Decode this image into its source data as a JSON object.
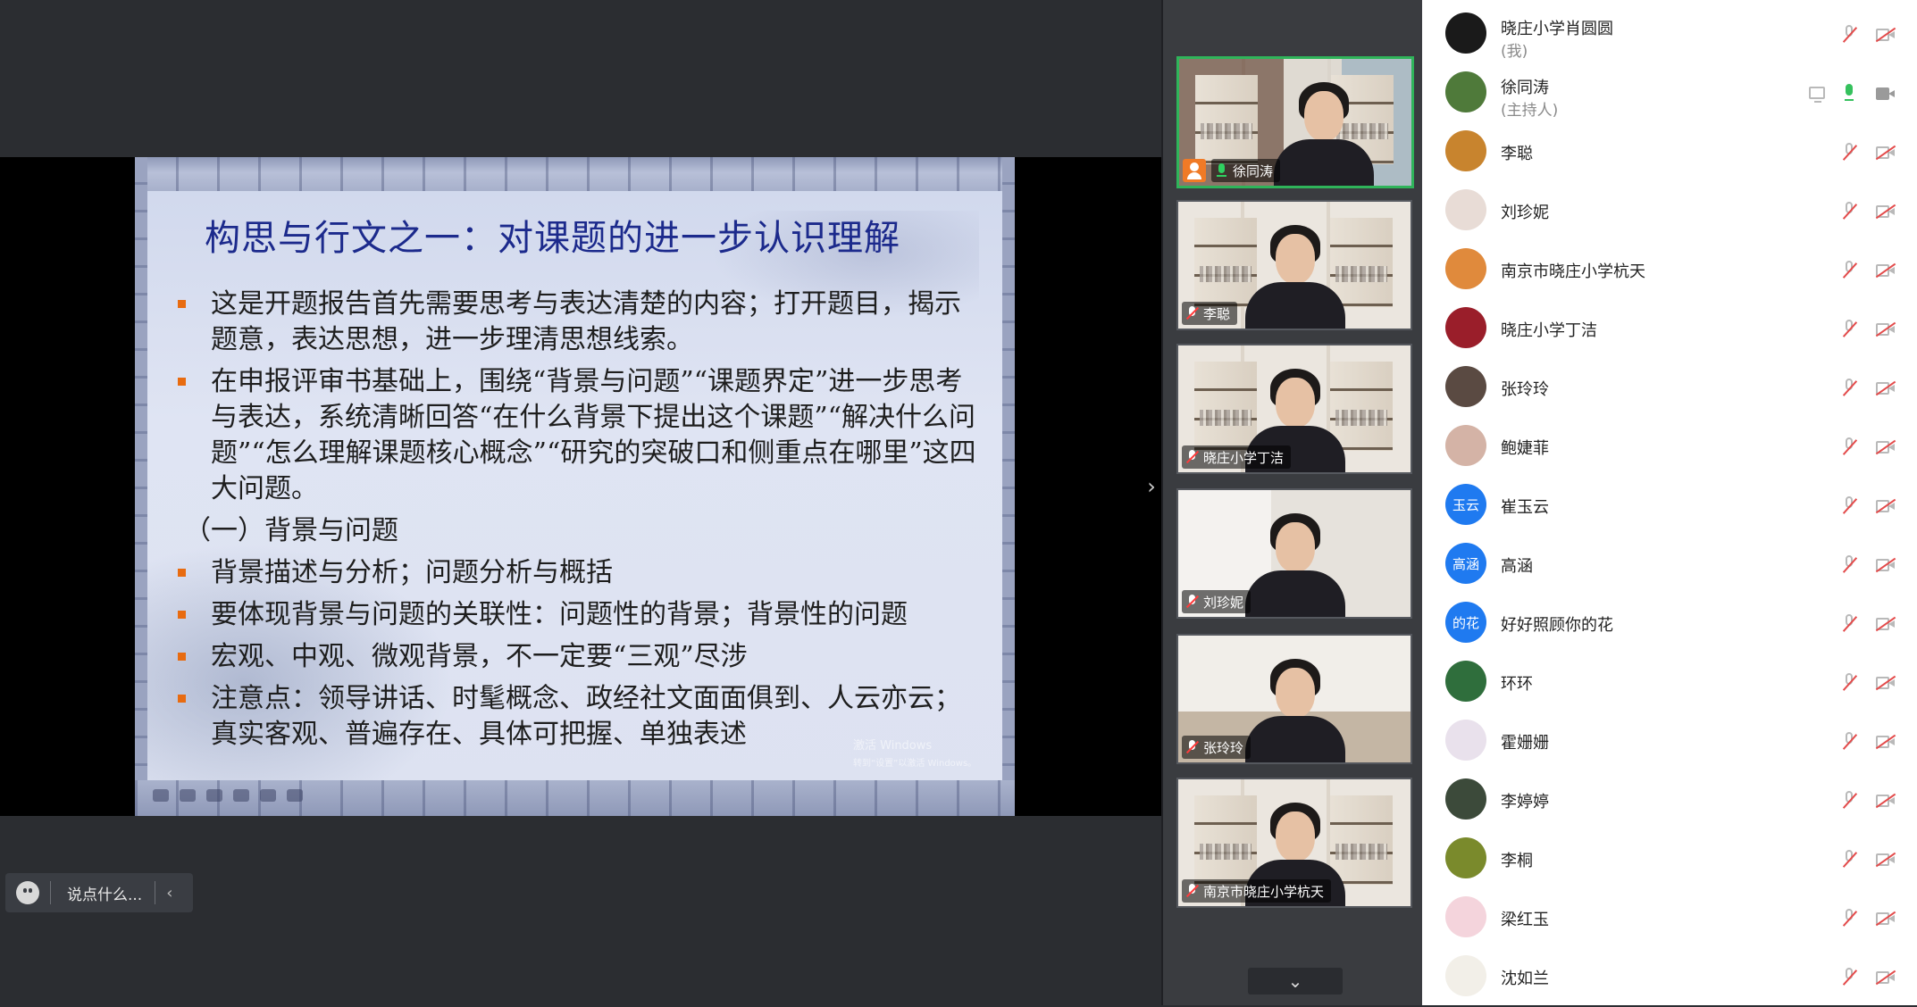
{
  "slide": {
    "title": "构思与行文之一：对课题的进一步认识理解",
    "bullets_top": [
      "这是开题报告首先需要思考与表达清楚的内容；打开题目，揭示题意，表达思想，进一步理清思想线索。",
      "在申报评审书基础上，围绕“背景与问题”“课题界定”进一步思考与表达，系统清晰回答“在什么背景下提出这个课题”“解决什么问题”“怎么理解课题核心概念”“研究的突破口和侧重点在哪里”这四大问题。"
    ],
    "subhead": "（一）背景与问题",
    "bullets_bottom": [
      "背景描述与分析；问题分析与概括",
      "要体现背景与问题的关联性：问题性的背景；背景性的问题",
      "宏观、中观、微观背景，不一定要“三观”尽涉",
      "注意点：领导讲话、时髦概念、政经社文面面俱到、人云亦云；真实客观、普遍存在、具体可把握、单独表述"
    ],
    "watermark_line1": "激活 Windows",
    "watermark_line2": "转到“设置”以激活 Windows。"
  },
  "comment_box": {
    "placeholder": "说点什么...",
    "collapse_glyph": "‹"
  },
  "collapse_handle": "›",
  "video_tiles": [
    {
      "name": "徐同涛",
      "mic": "on",
      "host": true,
      "active": true
    },
    {
      "name": "李聪",
      "mic": "muted"
    },
    {
      "name": "晓庄小学丁洁",
      "mic": "muted"
    },
    {
      "name": "刘珍妮",
      "mic": "muted"
    },
    {
      "name": "张玲玲",
      "mic": "muted"
    },
    {
      "name": "南京市晓庄小学杭天",
      "mic": "muted"
    }
  ],
  "scroll_down_glyph": "⌄",
  "participants": [
    {
      "name": "晓庄小学肖圆圆",
      "role": "(我)",
      "avatar_color": "#1a1a1a",
      "avatar_text": "",
      "mic": "muted",
      "cam": "off"
    },
    {
      "name": "徐同涛",
      "role": "(主持人)",
      "avatar_color": "#4f7a3a",
      "avatar_text": "",
      "mic": "on",
      "cam": "on",
      "screen": true
    },
    {
      "name": "李聪",
      "avatar_color": "#c8842e",
      "avatar_text": "",
      "mic": "muted",
      "cam": "off"
    },
    {
      "name": "刘珍妮",
      "avatar_color": "#e8dcd6",
      "avatar_text": "",
      "mic": "muted",
      "cam": "off"
    },
    {
      "name": "南京市晓庄小学杭天",
      "avatar_color": "#e08a3c",
      "avatar_text": "",
      "mic": "muted",
      "cam": "off"
    },
    {
      "name": "晓庄小学丁洁",
      "avatar_color": "#9a1e2a",
      "avatar_text": "",
      "mic": "muted",
      "cam": "off"
    },
    {
      "name": "张玲玲",
      "avatar_color": "#5a4a42",
      "avatar_text": "",
      "mic": "muted",
      "cam": "off"
    },
    {
      "name": "鲍婕菲",
      "avatar_color": "#d4b3a6",
      "avatar_text": "",
      "mic": "muted",
      "cam": "off"
    },
    {
      "name": "崔玉云",
      "avatar_color": "#1f7af0",
      "avatar_text": "玉云",
      "mic": "muted",
      "cam": "off"
    },
    {
      "name": "高涵",
      "avatar_color": "#1f7af0",
      "avatar_text": "高涵",
      "mic": "muted",
      "cam": "off"
    },
    {
      "name": "好好照顾你的花",
      "avatar_color": "#1f7af0",
      "avatar_text": "的花",
      "mic": "muted",
      "cam": "off"
    },
    {
      "name": "环环",
      "avatar_color": "#2f6e3c",
      "avatar_text": "",
      "mic": "muted",
      "cam": "off"
    },
    {
      "name": "霍姗姗",
      "avatar_color": "#e9e1ec",
      "avatar_text": "",
      "mic": "muted",
      "cam": "off"
    },
    {
      "name": "李婷婷",
      "avatar_color": "#3c4a3a",
      "avatar_text": "",
      "mic": "muted",
      "cam": "off"
    },
    {
      "name": "李桐",
      "avatar_color": "#7a8a2c",
      "avatar_text": "",
      "mic": "muted",
      "cam": "off"
    },
    {
      "name": "梁红玉",
      "avatar_color": "#f4d4dc",
      "avatar_text": "",
      "mic": "muted",
      "cam": "off"
    },
    {
      "name": "沈如兰",
      "avatar_color": "#f2efe8",
      "avatar_text": "",
      "mic": "muted",
      "cam": "off"
    }
  ]
}
